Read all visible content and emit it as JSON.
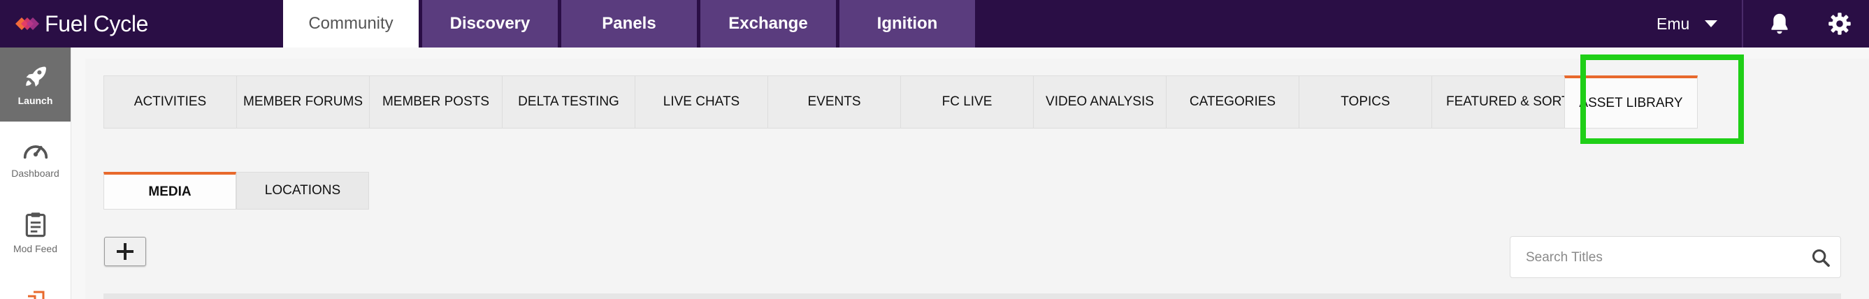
{
  "brand": {
    "name": "Fuel Cycle"
  },
  "top_tabs": [
    {
      "label": "Community",
      "active": true
    },
    {
      "label": "Discovery",
      "active": false
    },
    {
      "label": "Panels",
      "active": false
    },
    {
      "label": "Exchange",
      "active": false
    },
    {
      "label": "Ignition",
      "active": false
    }
  ],
  "user": {
    "name": "Emu"
  },
  "sidebar": {
    "items": [
      {
        "label": "Launch",
        "icon": "rocket-icon",
        "active": true
      },
      {
        "label": "Dashboard",
        "icon": "speedometer-icon",
        "active": false
      },
      {
        "label": "Mod Feed",
        "icon": "clipboard-icon",
        "active": false
      }
    ]
  },
  "section_tabs": [
    {
      "label": "ACTIVITIES",
      "active": false
    },
    {
      "label": "MEMBER FORUMS",
      "active": false
    },
    {
      "label": "MEMBER POSTS",
      "active": false
    },
    {
      "label": "DELTA TESTING",
      "active": false
    },
    {
      "label": "LIVE CHATS",
      "active": false
    },
    {
      "label": "EVENTS",
      "active": false
    },
    {
      "label": "FC LIVE",
      "active": false
    },
    {
      "label": "VIDEO ANALYSIS",
      "active": false
    },
    {
      "label": "CATEGORIES",
      "active": false
    },
    {
      "label": "TOPICS",
      "active": false
    },
    {
      "label": "FEATURED & SORTING",
      "active": false
    },
    {
      "label": "ASSET LIBRARY",
      "active": true
    }
  ],
  "sub_tabs": [
    {
      "label": "MEDIA",
      "active": true
    },
    {
      "label": "LOCATIONS",
      "active": false
    }
  ],
  "search": {
    "placeholder": "Search Titles",
    "value": ""
  },
  "colors": {
    "topbar": "#2a0e45",
    "tab_inactive": "#5a3c7e",
    "accent": "#e8692c",
    "highlight": "#1fcf17"
  }
}
